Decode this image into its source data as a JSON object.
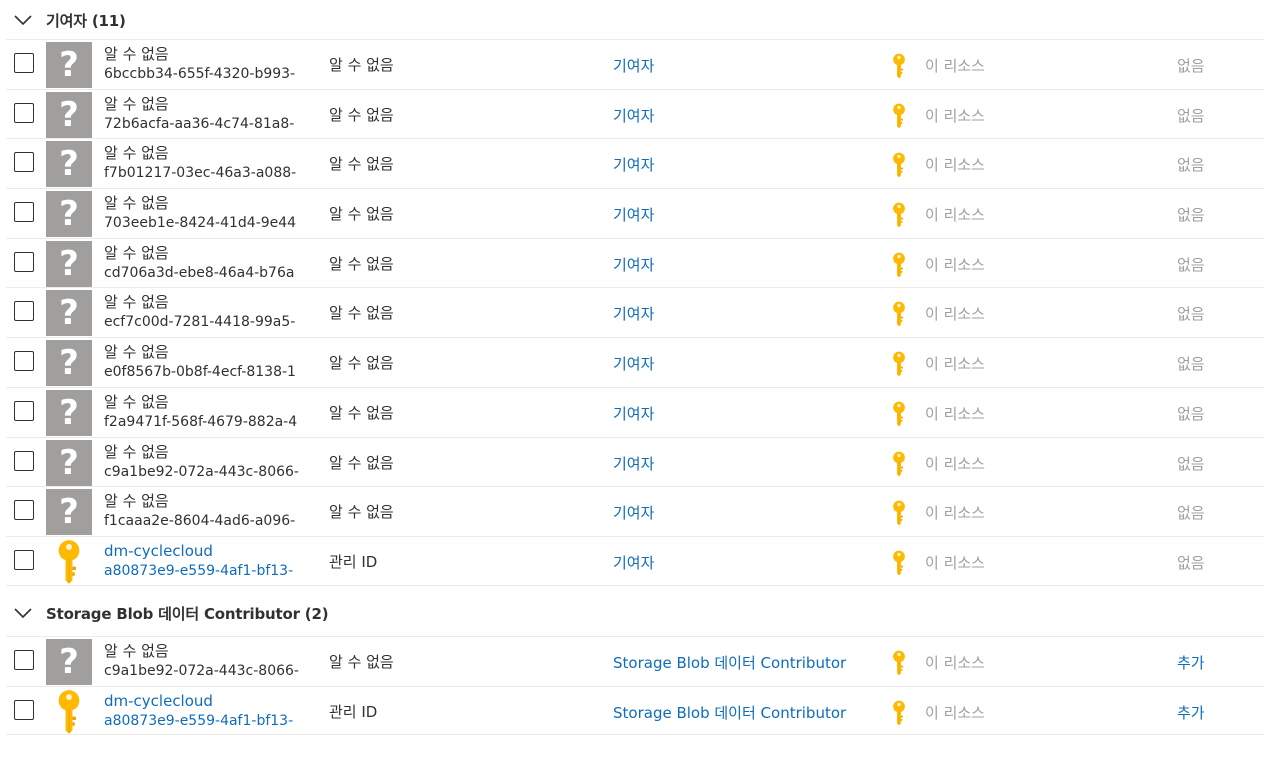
{
  "groups": [
    {
      "title": "기여자 (11)",
      "rows": [
        {
          "name": "알 수 없음",
          "id": "6bccbb34-655f-4320-b993-",
          "type": "알 수 없음",
          "role": "기여자",
          "scope": "이 리소스",
          "condition": "없음",
          "kind": "unknown"
        },
        {
          "name": "알 수 없음",
          "id": "72b6acfa-aa36-4c74-81a8-",
          "type": "알 수 없음",
          "role": "기여자",
          "scope": "이 리소스",
          "condition": "없음",
          "kind": "unknown"
        },
        {
          "name": "알 수 없음",
          "id": "f7b01217-03ec-46a3-a088-",
          "type": "알 수 없음",
          "role": "기여자",
          "scope": "이 리소스",
          "condition": "없음",
          "kind": "unknown"
        },
        {
          "name": "알 수 없음",
          "id": "703eeb1e-8424-41d4-9e44",
          "type": "알 수 없음",
          "role": "기여자",
          "scope": "이 리소스",
          "condition": "없음",
          "kind": "unknown"
        },
        {
          "name": "알 수 없음",
          "id": "cd706a3d-ebe8-46a4-b76a",
          "type": "알 수 없음",
          "role": "기여자",
          "scope": "이 리소스",
          "condition": "없음",
          "kind": "unknown"
        },
        {
          "name": "알 수 없음",
          "id": "ecf7c00d-7281-4418-99a5-",
          "type": "알 수 없음",
          "role": "기여자",
          "scope": "이 리소스",
          "condition": "없음",
          "kind": "unknown"
        },
        {
          "name": "알 수 없음",
          "id": "e0f8567b-0b8f-4ecf-8138-1",
          "type": "알 수 없음",
          "role": "기여자",
          "scope": "이 리소스",
          "condition": "없음",
          "kind": "unknown"
        },
        {
          "name": "알 수 없음",
          "id": "f2a9471f-568f-4679-882a-4",
          "type": "알 수 없음",
          "role": "기여자",
          "scope": "이 리소스",
          "condition": "없음",
          "kind": "unknown"
        },
        {
          "name": "알 수 없음",
          "id": "c9a1be92-072a-443c-8066-",
          "type": "알 수 없음",
          "role": "기여자",
          "scope": "이 리소스",
          "condition": "없음",
          "kind": "unknown"
        },
        {
          "name": "알 수 없음",
          "id": "f1caaa2e-8604-4ad6-a096-",
          "type": "알 수 없음",
          "role": "기여자",
          "scope": "이 리소스",
          "condition": "없음",
          "kind": "unknown"
        },
        {
          "name": "dm-cyclecloud",
          "id": "a80873e9-e559-4af1-bf13-",
          "type": "관리 ID",
          "role": "기여자",
          "scope": "이 리소스",
          "condition": "없음",
          "kind": "managed"
        }
      ]
    },
    {
      "title": "Storage Blob 데이터 Contributor (2)",
      "rows": [
        {
          "name": "알 수 없음",
          "id": "c9a1be92-072a-443c-8066-",
          "type": "알 수 없음",
          "role": "Storage Blob 데이터 Contributor",
          "scope": "이 리소스",
          "condition": "추가",
          "kind": "unknown"
        },
        {
          "name": "dm-cyclecloud",
          "id": "a80873e9-e559-4af1-bf13-",
          "type": "관리 ID",
          "role": "Storage Blob 데이터 Contributor",
          "scope": "이 리소스",
          "condition": "추가",
          "kind": "managed"
        }
      ]
    }
  ],
  "icons": {
    "unknown_avatar": "question-mark-icon",
    "managed_avatar": "key-icon",
    "scope": "key-icon"
  },
  "colors": {
    "link": "#0f6cbd",
    "muted": "#a19f9d",
    "key_gold": "#ffb900"
  }
}
